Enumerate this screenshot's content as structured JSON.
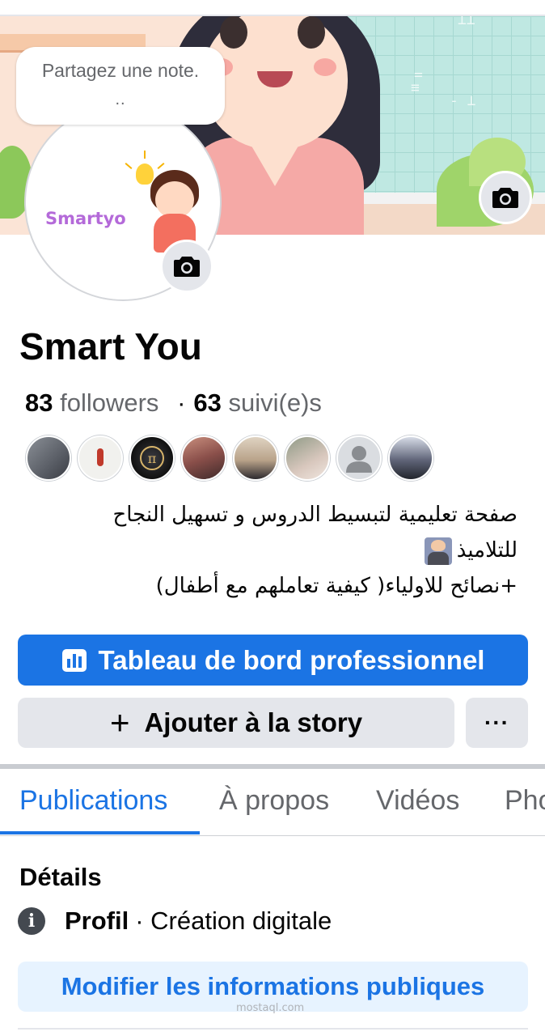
{
  "cover": {
    "chalk_marks": [
      "⊥⊥",
      "=",
      "- ⊥",
      "≡"
    ]
  },
  "avatar": {
    "logo_text": "Smartyo"
  },
  "note": {
    "placeholder": "Partagez une note.",
    "dots": ".."
  },
  "profile": {
    "name": "Smart You",
    "followers_count": "83",
    "followers_label": "followers",
    "separator": "·",
    "following_count": "63",
    "following_label": "suivi(e)s"
  },
  "followers_preview": [
    {
      "icon": "avatar-photo",
      "color": "#6b6f76"
    },
    {
      "icon": "avatar-photo",
      "color": "#f1f1ee"
    },
    {
      "icon": "avatar-pi",
      "color": "#1d1d22"
    },
    {
      "icon": "avatar-photo",
      "color": "#8a4f4a"
    },
    {
      "icon": "avatar-photo",
      "color": "#c9b59e"
    },
    {
      "icon": "avatar-photo",
      "color": "#a8a094"
    },
    {
      "icon": "default-avatar-icon",
      "color": "#bcc0c4"
    },
    {
      "icon": "avatar-photo",
      "color": "#4a4f66"
    }
  ],
  "bio": {
    "line1": "صفحة تعليمية لتبسيط الدروس و تسهيل النجاح",
    "line2": "للتلاميذ",
    "line3": "+نصائح للاولياء( كيفية تعاملهم مع أطفال)"
  },
  "actions": {
    "dashboard_label": "Tableau de bord professionnel",
    "story_label": "Ajouter à la story",
    "more_label": "···"
  },
  "tabs": [
    {
      "label": "Publications",
      "active": true
    },
    {
      "label": "À propos",
      "active": false
    },
    {
      "label": "Vidéos",
      "active": false
    },
    {
      "label": "Pho",
      "active": false
    }
  ],
  "details": {
    "title": "Détails",
    "category_label": "Profil",
    "category_value": "· Création digitale",
    "edit_label": "Modifier les informations publiques"
  },
  "watermark": "mostaql.com",
  "colors": {
    "accent": "#1b74e4",
    "secondary_bg": "#e4e6eb",
    "muted_text": "#65676b"
  }
}
